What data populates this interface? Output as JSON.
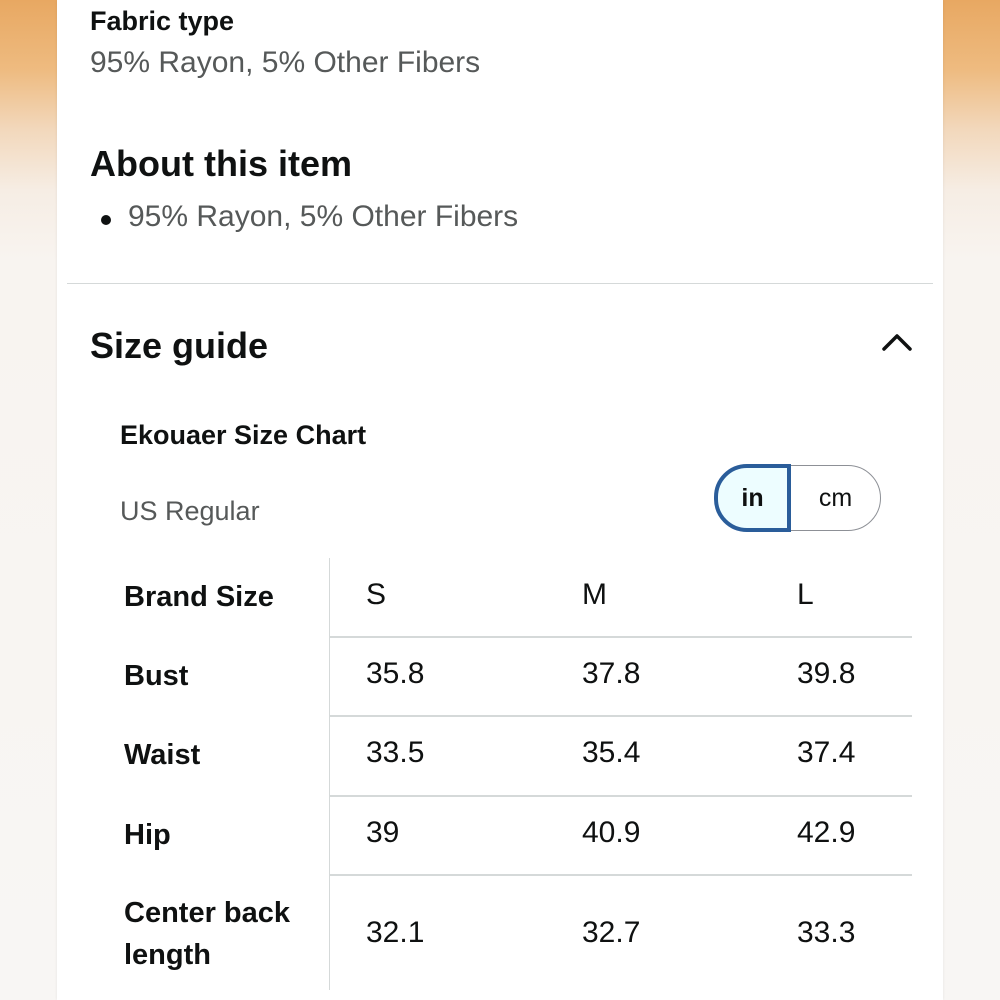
{
  "fabric": {
    "label": "Fabric type",
    "value": "95% Rayon, 5% Other Fibers"
  },
  "about": {
    "title": "About this item",
    "bullets": [
      "95% Rayon, 5% Other Fibers"
    ]
  },
  "size_guide": {
    "title": "Size guide",
    "chart_title": "Ekouaer Size Chart",
    "region": "US Regular",
    "units": [
      "in",
      "cm"
    ],
    "selected_unit": "in",
    "table": {
      "header_label": "Brand Size",
      "sizes": [
        "S",
        "M",
        "L"
      ],
      "rows": [
        {
          "label": "Bust",
          "values": [
            "35.8",
            "37.8",
            "39.8"
          ]
        },
        {
          "label": "Waist",
          "values": [
            "33.5",
            "35.4",
            "37.4"
          ]
        },
        {
          "label": "Hip",
          "values": [
            "39",
            "40.9",
            "42.9"
          ]
        },
        {
          "label": "Center back length",
          "values": [
            "32.1",
            "32.7",
            "33.3"
          ]
        }
      ]
    }
  },
  "colors": {
    "text_primary": "#0f1111",
    "text_secondary": "#565959",
    "toggle_selected_border": "#2a5d9a",
    "toggle_selected_bg": "#edfdff",
    "divider": "#d5d9d9"
  },
  "icons": {
    "collapse": "chevron-up-icon"
  }
}
